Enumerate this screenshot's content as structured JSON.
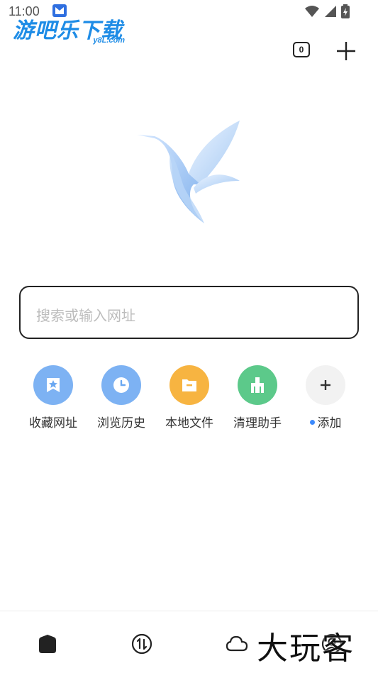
{
  "status_bar": {
    "time": "11:00",
    "icons": [
      "app-notification-icon",
      "wifi-icon",
      "signal-icon",
      "battery-icon"
    ]
  },
  "watermark": {
    "logo_text": "游吧乐下载",
    "logo_sub": "y8L.com",
    "bottom_text": "大玩客"
  },
  "toolbar": {
    "tab_count": "0",
    "new_tab_icon": "plus-icon"
  },
  "center_logo": {
    "icon": "bird-logo-icon"
  },
  "search": {
    "placeholder": "搜索或输入网址"
  },
  "shortcuts": [
    {
      "label": "收藏网址",
      "icon": "bookmark-star-icon",
      "color": "#6aa8f2"
    },
    {
      "label": "浏览历史",
      "icon": "clock-icon",
      "color": "#6aa8f2"
    },
    {
      "label": "本地文件",
      "icon": "folder-icon",
      "color": "#f7b441"
    },
    {
      "label": "清理助手",
      "icon": "broom-icon",
      "color": "#5cc98a"
    },
    {
      "label": "添加",
      "icon": "plus-icon",
      "color": "#f2f2f2"
    }
  ],
  "bottom_nav": [
    {
      "name": "home",
      "icon": "home-icon"
    },
    {
      "name": "transfer",
      "icon": "transfer-icon"
    },
    {
      "name": "cloud",
      "icon": "cloud-icon"
    },
    {
      "name": "profile",
      "icon": "profile-icon"
    }
  ],
  "colors": {
    "accent": "#3d8bfd",
    "border": "#222222",
    "placeholder": "#bdbdbd"
  }
}
